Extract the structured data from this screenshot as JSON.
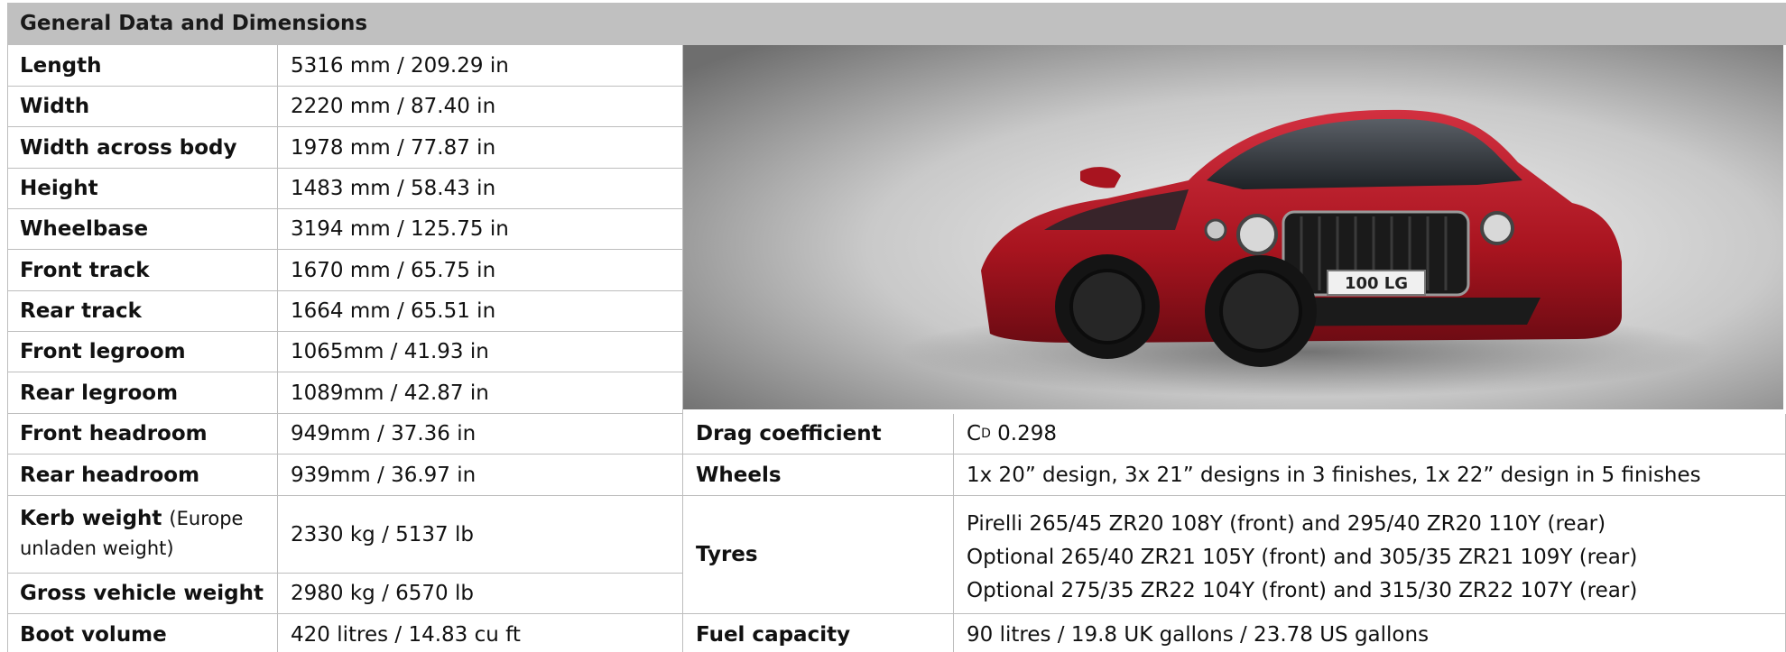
{
  "title": "General Data and Dimensions",
  "left_rows": [
    {
      "label": "Length",
      "value": "5316 mm / 209.29 in"
    },
    {
      "label": "Width",
      "value": "2220 mm / 87.40 in"
    },
    {
      "label": "Width across body",
      "value": "1978 mm / 77.87 in"
    },
    {
      "label": "Height",
      "value": "1483 mm / 58.43 in"
    },
    {
      "label": "Wheelbase",
      "value": "3194 mm / 125.75 in"
    },
    {
      "label": "Front track",
      "value": "1670 mm / 65.75 in"
    },
    {
      "label": "Rear track",
      "value": "1664 mm / 65.51 in"
    },
    {
      "label": "Front legroom",
      "value": "1065mm / 41.93 in"
    },
    {
      "label": "Rear legroom",
      "value": "1089mm / 42.87 in"
    },
    {
      "label": "Front headroom",
      "value": "949mm / 37.36 in"
    },
    {
      "label": "Rear headroom",
      "value": "939mm / 36.97 in"
    },
    {
      "label": "Kerb weight",
      "label_note": "(Europe unladen weight)",
      "value": "2330 kg / 5137 lb"
    },
    {
      "label": "Gross vehicle weight",
      "value": "2980 kg / 6570 lb"
    },
    {
      "label": "Boot volume",
      "value": "420 litres / 14.83 cu ft"
    }
  ],
  "right_rows": {
    "drag": {
      "label": "Drag coefficient",
      "prefix": "C",
      "subscript": "D",
      "value": "0.298"
    },
    "wheels": {
      "label": "Wheels",
      "value": "1x 20” design, 3x 21” designs in 3 finishes, 1x 22” design in 5 finishes"
    },
    "tyres": {
      "label": "Tyres",
      "values": [
        "Pirelli 265/45 ZR20 108Y (front) and 295/40 ZR20 110Y (rear)",
        "Optional 265/40 ZR21 105Y (front) and 305/35 ZR21 109Y (rear)",
        "Optional 275/35 ZR22 104Y (front) and 315/30 ZR22 107Y (rear)"
      ]
    },
    "fuel": {
      "label": "Fuel capacity",
      "value": "90 litres / 19.8 UK gallons / 23.78 US gallons"
    }
  },
  "photo": {
    "plate_text": "100 LG",
    "car_color": "#b01824"
  }
}
